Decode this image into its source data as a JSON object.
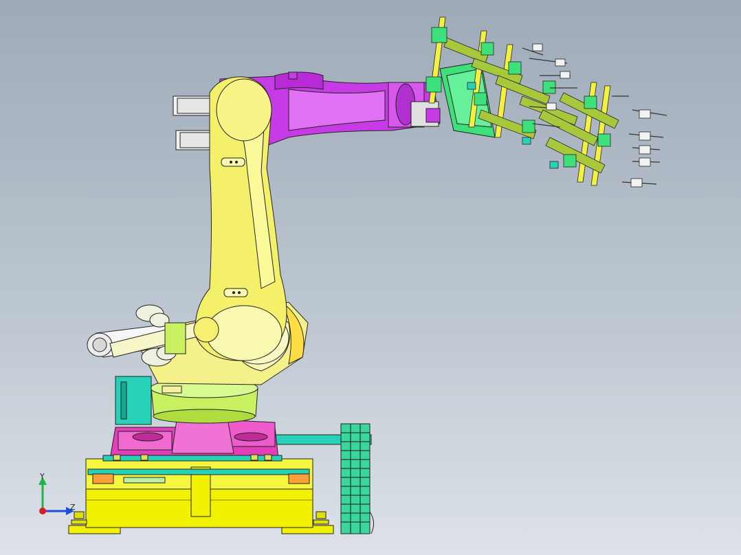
{
  "viewport": {
    "background_top": "#9eaab8",
    "background_bottom": "#dde2e8"
  },
  "triad": {
    "y_label": "Y",
    "z_label": "Z",
    "y_color": "#21b24a",
    "z_color": "#1f4fd8",
    "x_color": "#d81f26"
  },
  "colors": {
    "base_frame": "#f2f200",
    "turntable": "#e23fb8",
    "rotary_ring": "#c8f060",
    "arm": "#f4f08a",
    "forearm": "#c63be6",
    "motor": "#28d2b8",
    "drag_chain": "#3ad69e",
    "gripper_finger": "#a8c83c",
    "outline": "#222222"
  },
  "icons": {
    "triad": "coordinate-triad-icon"
  }
}
